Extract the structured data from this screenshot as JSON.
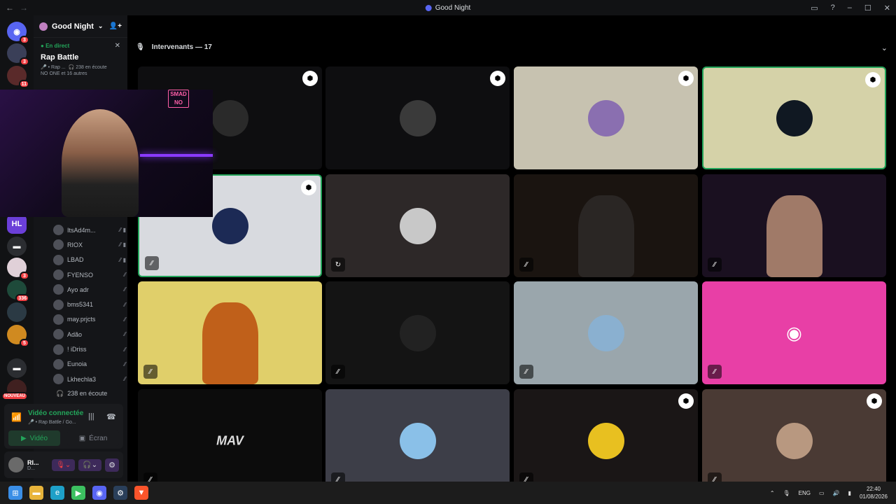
{
  "window": {
    "title": "Good Night",
    "back_icon": "arrow-left-icon",
    "forward_icon": "arrow-right-icon"
  },
  "servers": [
    {
      "icon": "discord-icon",
      "badge": "3",
      "color": "#5865f2"
    },
    {
      "icon": "server-avatar",
      "badge": "3",
      "color": "#3a3f58"
    },
    {
      "icon": "server-avatar",
      "badge": "11",
      "color": "#5a2a2a"
    },
    {
      "icon": "HL",
      "badge": "",
      "color": "#6b3fd8"
    },
    {
      "icon": "folder-icon",
      "badge": "",
      "color": "#2b2d31"
    },
    {
      "icon": "server-avatar",
      "badge": "3",
      "color": "#e0d0d8"
    },
    {
      "icon": "server-avatar",
      "badge": "336",
      "color": "#1e4a3a"
    },
    {
      "icon": "server-avatar",
      "badge": "",
      "color": "#2b3a44"
    },
    {
      "icon": "server-avatar",
      "badge": "5",
      "color": "#d08a20"
    },
    {
      "icon": "folder-icon",
      "badge": "",
      "color": "#2b2d31"
    },
    {
      "icon": "server-avatar",
      "badge": "NOUVEAU",
      "color": "#402020"
    }
  ],
  "guild": {
    "name": "Good Night",
    "chevron": "chevron-down-icon",
    "add_member_icon": "add-member-icon"
  },
  "live": {
    "tag": "En direct",
    "event_name": "Rap Battle",
    "meta1_a": "🎤 • Rap ...",
    "meta1_b": "238 en écoute",
    "meta2": "NO ONE et 16 autres",
    "close_icon": "close-icon"
  },
  "voice_users": [
    {
      "name": "ItsAd4m...",
      "icons": "⁄⁄ ▮"
    },
    {
      "name": "RIOX",
      "icons": "⁄⁄ ▮"
    },
    {
      "name": "LBAD",
      "icons": "⁄⁄ ▮"
    },
    {
      "name": "FYENSO",
      "icons": "⁄⁄"
    },
    {
      "name": "Ayo adr",
      "icons": "⁄⁄"
    },
    {
      "name": "bms5341",
      "icons": "⁄⁄"
    },
    {
      "name": "may.prjcts",
      "icons": "⁄⁄"
    },
    {
      "name": "Adão",
      "icons": "⁄⁄"
    },
    {
      "name": "! iDriss",
      "icons": "⁄⁄"
    },
    {
      "name": "Eunoia",
      "icons": "⁄⁄"
    },
    {
      "name": "Lkhechla3",
      "icons": "⁄⁄"
    }
  ],
  "listeners": "238 en écoute",
  "voice_panel": {
    "status": "Vidéo connectée",
    "channel": "🎤 • Rap Battle / Go...",
    "video_label": "Vidéo",
    "screen_label": "Écran"
  },
  "user_panel": {
    "name": "RI...",
    "status": "D..."
  },
  "stage": {
    "header": "Intervenants — 17",
    "mic_icon": "microphone-icon",
    "chevron": "chevron-down-icon"
  },
  "tiles": [
    {
      "bg": "#0e0e10",
      "avatar": "#2a2a2a",
      "mod": true,
      "mute": ""
    },
    {
      "bg": "#0e0e10",
      "avatar": "#3a3a3a",
      "mod": true,
      "mute": ""
    },
    {
      "bg": "#c7c2b0",
      "avatar": "#8a6fb0",
      "mod": true,
      "mute": ""
    },
    {
      "bg": "#d5d2a8",
      "avatar": "#101822",
      "mod": true,
      "mute": ""
    },
    {
      "bg": "#d8dadf",
      "avatar": "#1c2a55",
      "mod": true,
      "mute": "⁄⁄"
    },
    {
      "bg": "#2d2828",
      "avatar": "#c8c8c8",
      "mod": false,
      "mute": "↻"
    },
    {
      "bg": "#1a1410",
      "avatar": "#2a2624",
      "mod": false,
      "mute": "⁄⁄"
    },
    {
      "bg": "#1a1020",
      "avatar": "#a07a68",
      "mod": false,
      "mute": "⁄⁄"
    },
    {
      "bg": "#e0cf6a",
      "avatar": "#c0601a",
      "mod": false,
      "mute": "⁄⁄"
    },
    {
      "bg": "#141414",
      "avatar": "#222",
      "mod": false,
      "mute": "⁄⁄"
    },
    {
      "bg": "#9aa6ac",
      "avatar": "#8ab0d0",
      "mod": false,
      "mute": "⁄⁄"
    },
    {
      "bg": "#e83fa6",
      "avatar": "#e83fa6",
      "mod": false,
      "mute": "⁄⁄"
    },
    {
      "bg": "#0c0c0c",
      "avatar": "#111",
      "mod": false,
      "mute": "⁄⁄"
    },
    {
      "bg": "#3d3e48",
      "avatar": "#8ac0e8",
      "mod": false,
      "mute": "⁄⁄"
    },
    {
      "bg": "#1a1616",
      "avatar": "#e8c020",
      "mod": true,
      "mute": "⁄⁄"
    },
    {
      "bg": "#4a3a34",
      "avatar": "#b89880",
      "mod": true,
      "mute": "⁄⁄"
    }
  ],
  "tile_text": {
    "may_logo": "MAV"
  },
  "taskbar": {
    "lang": "ENG",
    "time": "22:40",
    "date": "01/08/2026",
    "apps": [
      {
        "icon": "windows-start-icon",
        "color": "#3a8ee6",
        "glyph": "⊞"
      },
      {
        "icon": "file-explorer-icon",
        "color": "#e8b43a",
        "glyph": "▬"
      },
      {
        "icon": "edge-icon",
        "color": "#1ea0c8",
        "glyph": "e"
      },
      {
        "icon": "media-player-icon",
        "color": "#3cc060",
        "glyph": "▶"
      },
      {
        "icon": "discord-app-icon",
        "color": "#5865f2",
        "glyph": "◉"
      },
      {
        "icon": "steam-icon",
        "color": "#2a3f5a",
        "glyph": "⚙"
      },
      {
        "icon": "brave-icon",
        "color": "#fb542b",
        "glyph": "▼"
      }
    ]
  }
}
